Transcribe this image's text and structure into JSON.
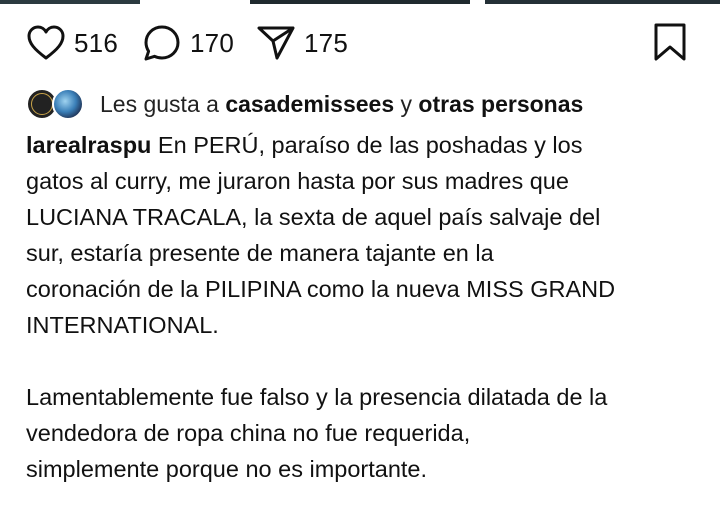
{
  "post": {
    "like_count": "516",
    "comment_count": "170",
    "share_count": "175"
  },
  "likes": {
    "prefix": "Les gusta a ",
    "user": "casademissees",
    "connector": " y ",
    "others": "otras personas"
  },
  "caption": {
    "username": "larealraspu",
    "paragraph1_lines": [
      " En PERÚ, paraíso de las poshadas y los",
      "gatos al curry, me juraron hasta por sus madres que",
      "LUCIANA TRACALA, la sexta de aquel país salvaje del",
      "sur,  estaría presente de manera tajante en la",
      "coronación de la PILIPINA como la nueva MISS GRAND",
      "INTERNATIONAL."
    ],
    "paragraph2_lines": [
      "Lamentablemente fue falso y la presencia dilatada de la",
      "vendedora de ropa china no fue requerida,",
      "simplemente porque no es importante."
    ]
  },
  "icons": {
    "like": "heart-outline-icon",
    "comment": "comment-bubble-icon",
    "share": "paper-plane-icon",
    "save": "bookmark-icon"
  },
  "colors": {
    "text": "#111111",
    "background": "#ffffff"
  }
}
